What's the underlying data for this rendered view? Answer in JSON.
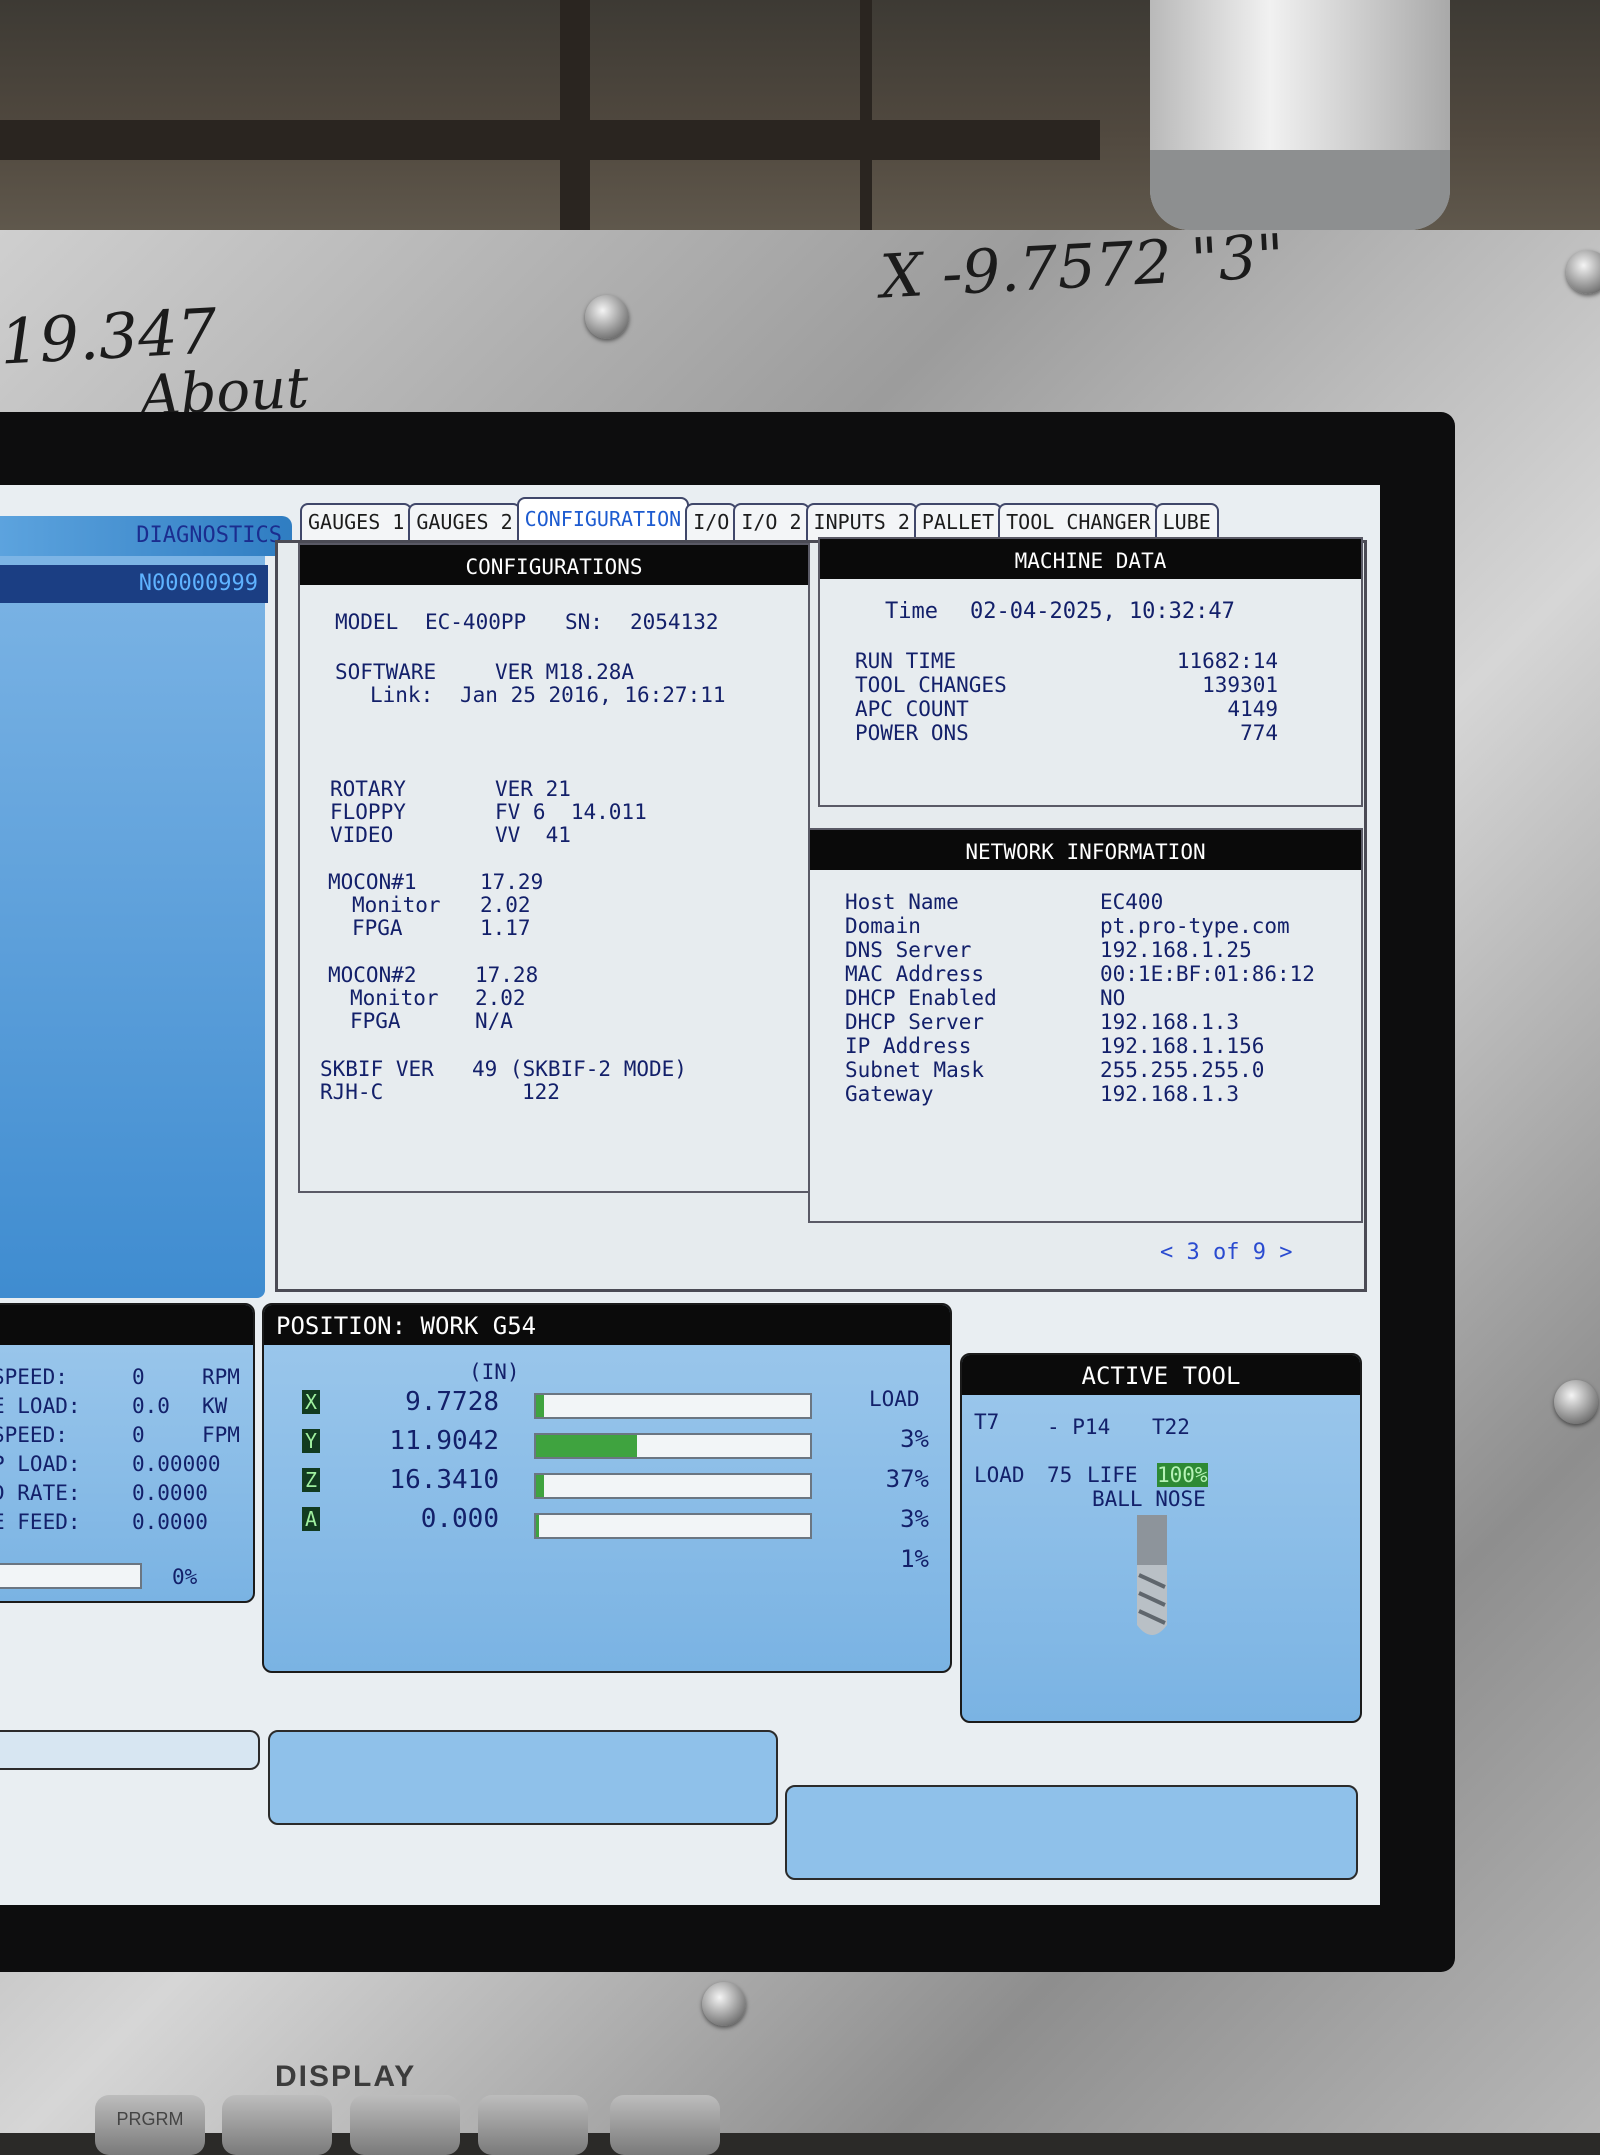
{
  "handwriting": {
    "left_number": "19.347",
    "left_note": "About",
    "top_note": "X -9.7572 \"3\""
  },
  "left_panel": {
    "diagnostics_tab": "DIAGNOSTICS",
    "program_number": "N00000999"
  },
  "tabs": [
    {
      "label": "GAUGES 1",
      "active": false
    },
    {
      "label": "GAUGES 2",
      "active": false
    },
    {
      "label": "CONFIGURATION",
      "active": true
    },
    {
      "label": "I/O",
      "active": false
    },
    {
      "label": "I/O 2",
      "active": false
    },
    {
      "label": "INPUTS 2",
      "active": false
    },
    {
      "label": "PALLET",
      "active": false
    },
    {
      "label": "TOOL CHANGER",
      "active": false
    },
    {
      "label": "LUBE",
      "active": false
    }
  ],
  "configurations": {
    "header": "CONFIGURATIONS",
    "model_label": "MODEL",
    "model": "EC-400PP",
    "sn_label": "SN:",
    "sn": "2054132",
    "software_label": "SOFTWARE",
    "software": "VER M18.28A",
    "link_label": "Link:",
    "link": "Jan 25 2016, 16:27:11",
    "rotary_label": "ROTARY",
    "rotary": "VER 21",
    "floppy_label": "FLOPPY",
    "floppy": "FV 6  14.011",
    "video_label": "VIDEO",
    "video": "VV  41",
    "mocon1_label": "MOCON#1",
    "mocon1": "17.29",
    "mocon1_monitor_label": "Monitor",
    "mocon1_monitor": "2.02",
    "mocon1_fpga_label": "FPGA",
    "mocon1_fpga": "1.17",
    "mocon2_label": "MOCON#2",
    "mocon2": "17.28",
    "mocon2_monitor_label": "Monitor",
    "mocon2_monitor": "2.02",
    "mocon2_fpga_label": "FPGA",
    "mocon2_fpga": "N/A",
    "skbif_label": "SKBIF VER",
    "skbif": "49 (SKBIF-2 MODE)",
    "rjhc_label": "RJH-C",
    "rjhc": "122"
  },
  "machine_data": {
    "header": "MACHINE DATA",
    "time_label": "Time",
    "time": "02-04-2025, 10:32:47",
    "rows": [
      {
        "label": "RUN TIME",
        "value": "11682:14"
      },
      {
        "label": "TOOL CHANGES",
        "value": "139301"
      },
      {
        "label": "APC COUNT",
        "value": "4149"
      },
      {
        "label": "POWER ONS",
        "value": "774"
      }
    ]
  },
  "network": {
    "header": "NETWORK INFORMATION",
    "rows": [
      {
        "label": "Host Name",
        "value": "EC400"
      },
      {
        "label": "Domain",
        "value": "pt.pro-type.com"
      },
      {
        "label": "DNS Server",
        "value": "192.168.1.25"
      },
      {
        "label": "MAC Address",
        "value": "00:1E:BF:01:86:12"
      },
      {
        "label": "DHCP Enabled",
        "value": "NO"
      },
      {
        "label": "DHCP Server",
        "value": "192.168.1.3"
      },
      {
        "label": "IP Address",
        "value": "192.168.1.156"
      },
      {
        "label": "Subnet Mask",
        "value": "255.255.255.0"
      },
      {
        "label": "Gateway",
        "value": "192.168.1.3"
      }
    ]
  },
  "pager": "< 3 of 9 >",
  "spindle": {
    "rows": [
      {
        "label": "SPEED:",
        "value": "0",
        "unit": "RPM"
      },
      {
        "label": "E LOAD:",
        "value": "0.0",
        "unit": "KW"
      },
      {
        "label": "SPEED:",
        "value": "0",
        "unit": "FPM"
      },
      {
        "label": "P LOAD:",
        "value": "0.00000",
        "unit": ""
      },
      {
        "label": "D RATE:",
        "value": "0.0000",
        "unit": ""
      },
      {
        "label": "E FEED:",
        "value": "0.0000",
        "unit": ""
      }
    ],
    "bar_percent_text": "0%"
  },
  "position": {
    "header": "POSITION:  WORK   G54",
    "units": "(IN)",
    "load_label": "LOAD",
    "axes": [
      {
        "axis": "X",
        "value": "9.7728",
        "load_text": "3%",
        "load": 3
      },
      {
        "axis": "Y",
        "value": "11.9042",
        "load_text": "37%",
        "load": 37
      },
      {
        "axis": "Z",
        "value": "16.3410",
        "load_text": "3%",
        "load": 3
      },
      {
        "axis": "A",
        "value": "0.000",
        "load_text": "1%",
        "load": 1
      }
    ]
  },
  "active_tool": {
    "header": "ACTIVE TOOL",
    "tool": "T7",
    "pocket": "- P14",
    "t_num": "T22",
    "load_label": "LOAD",
    "load": "75",
    "life_label": "LIFE",
    "life": "100%",
    "type": "BALL NOSE"
  },
  "keypad": {
    "display_label": "DISPLAY",
    "prgrm_key": "PRGRM"
  },
  "colors": {
    "load_fill": "#3fa33f",
    "accent_blue": "#1d5bd0",
    "panel_blue": "#7ab3e3"
  }
}
